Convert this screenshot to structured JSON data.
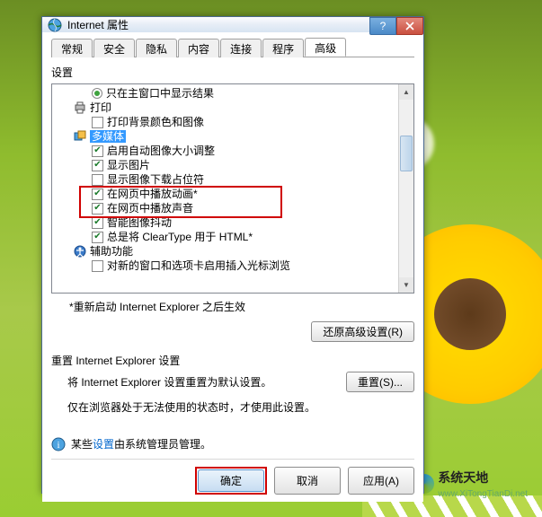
{
  "window": {
    "title": "Internet 属性"
  },
  "tabs": {
    "general": "常规",
    "security": "安全",
    "privacy": "隐私",
    "content": "内容",
    "connections": "连接",
    "programs": "程序",
    "advanced": "高级"
  },
  "settings_label": "设置",
  "tree": {
    "row_only_main_window": "只在主窗口中显示结果",
    "printing": "打印",
    "print_bg": "打印背景颜色和图像",
    "multimedia": "多媒体",
    "auto_resize": "启用自动图像大小调整",
    "show_images": "显示图片",
    "show_placeholders": "显示图像下载占位符",
    "play_animations": "在网页中播放动画*",
    "play_sounds": "在网页中播放声音",
    "smart_dither": "智能图像抖动",
    "cleartype": "总是将 ClearType 用于 HTML*",
    "accessibility": "辅助功能",
    "caret_browsing": "对新的窗口和选项卡启用插入光标浏览"
  },
  "restart_note": "*重新启动 Internet Explorer 之后生效",
  "restore_defaults_btn": "还原高级设置(R)",
  "reset": {
    "heading": "重置 Internet Explorer 设置",
    "desc": "将 Internet Explorer 设置重置为默认设置。",
    "btn": "重置(S)...",
    "warning": "仅在浏览器处于无法使用的状态时，才使用此设置。"
  },
  "admin_note": {
    "prefix": "某些",
    "link": "设置",
    "suffix": "由系统管理员管理。"
  },
  "footer": {
    "ok": "确定",
    "cancel": "取消",
    "apply": "应用(A)"
  },
  "watermark": {
    "name": "系统天地",
    "url": "www.XiTongTianDi.net"
  }
}
